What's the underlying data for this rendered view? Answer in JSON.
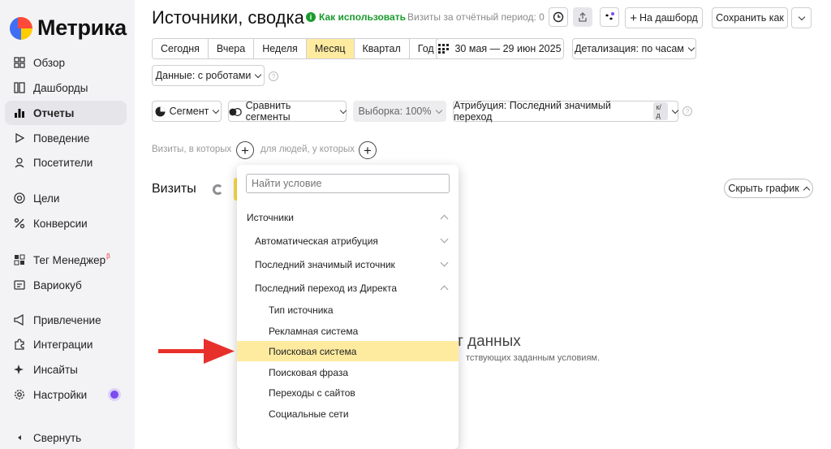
{
  "app": {
    "logo_text": "Метрика"
  },
  "sidebar": {
    "items": [
      {
        "label": "Обзор",
        "icon": "grid-icon"
      },
      {
        "label": "Дашборды",
        "icon": "dashboard-icon"
      },
      {
        "label": "Отчеты",
        "icon": "chart-icon"
      },
      {
        "label": "Поведение",
        "icon": "play-icon"
      },
      {
        "label": "Посетители",
        "icon": "user-icon"
      },
      {
        "label": "Цели",
        "icon": "target-icon"
      },
      {
        "label": "Конверсии",
        "icon": "percent-icon"
      },
      {
        "label": "Тег Менеджер",
        "icon": "tag-icon",
        "sup": "β"
      },
      {
        "label": "Вариокуб",
        "icon": "cube-icon"
      },
      {
        "label": "Привлечение",
        "icon": "megaphone-icon"
      },
      {
        "label": "Интеграции",
        "icon": "puzzle-icon"
      },
      {
        "label": "Инсайты",
        "icon": "sparkle-icon"
      },
      {
        "label": "Настройки",
        "icon": "gear-icon"
      }
    ],
    "active_index": 2,
    "collapse_label": "Свернуть"
  },
  "header": {
    "title": "Источники, сводка",
    "howto_label": "Как использовать",
    "visits_note": "Визиты за отчётный период: 0",
    "add_dashboard_label": "На дашборд",
    "save_as_label": "Сохранить как"
  },
  "periods": {
    "items": [
      "Сегодня",
      "Вчера",
      "Неделя",
      "Месяц",
      "Квартал",
      "Год"
    ],
    "selected": "Месяц",
    "date_range": "30 мая — 29 июн 2025",
    "detail": "Детализация: по часам",
    "data_filter": "Данные: с роботами"
  },
  "filters": {
    "segment": "Сегмент",
    "compare": "Сравнить сегменты",
    "sample": "Выборка: 100%",
    "attribution": "Атрибуция: Последний значимый переход",
    "attribution_badge": "к/д"
  },
  "conditions": {
    "visits_label": "Визиты, в которых",
    "people_label": "для людей, у которых"
  },
  "content": {
    "visits_title": "Визиты",
    "hide_chart": "Скрыть график",
    "no_data": "т данных",
    "no_data_sub": "тствующих заданным условиям."
  },
  "dropdown": {
    "search_placeholder": "Найти условие",
    "items": [
      {
        "label": "Источники",
        "level": 0,
        "state": "up"
      },
      {
        "label": "Автоматическая атрибуция",
        "level": 1,
        "state": "down"
      },
      {
        "label": "Последний значимый источник",
        "level": 1,
        "state": "down"
      },
      {
        "label": "Последний переход из Директа",
        "level": 1,
        "state": "up"
      },
      {
        "label": "Тип источника",
        "level": 2,
        "state": ""
      },
      {
        "label": "Рекламная система",
        "level": 2,
        "state": ""
      },
      {
        "label": "Поисковая система",
        "level": 2,
        "state": "",
        "highlighted": true
      },
      {
        "label": "Поисковая фраза",
        "level": 2,
        "state": ""
      },
      {
        "label": "Переходы с сайтов",
        "level": 2,
        "state": ""
      },
      {
        "label": "Социальные сети",
        "level": 2,
        "state": ""
      }
    ]
  },
  "annotation": {
    "color": "#e8302a"
  }
}
